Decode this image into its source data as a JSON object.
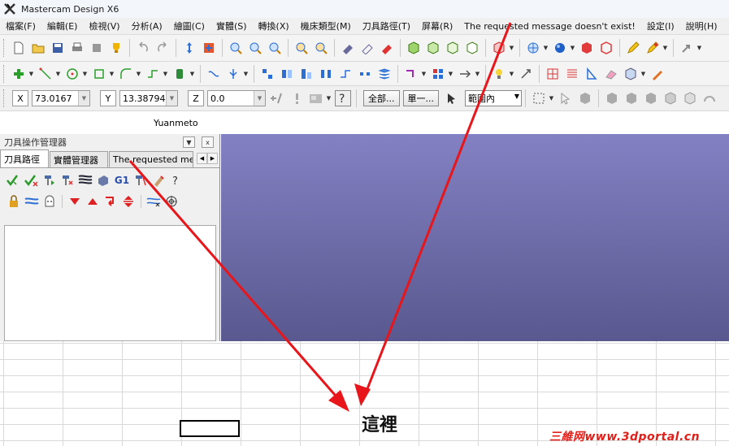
{
  "window": {
    "title": "Mastercam Design X6"
  },
  "menu": [
    "檔案(F)",
    "編輯(E)",
    "檢視(V)",
    "分析(A)",
    "繪圖(C)",
    "實體(S)",
    "轉換(X)",
    "機床類型(M)",
    "刀具路徑(T)",
    "屏幕(R)",
    "The requested message doesn't exist!",
    "設定(I)",
    "說明(H)"
  ],
  "coords": {
    "x_label": "X",
    "x_value": "73.0167",
    "y_label": "Y",
    "y_value": "13.38794",
    "z_label": "Z",
    "z_value": "0.0"
  },
  "selection": {
    "all_button": "全部...",
    "single_button": "單一...",
    "range_value": "範圍內"
  },
  "user": {
    "name": "Yuanmeto"
  },
  "panel": {
    "title": "刀具操作管理器",
    "close_glyph": "x",
    "tabs": [
      "刀具路徑",
      "實體管理器",
      "The requested messa"
    ],
    "g1_label": "G1"
  },
  "annotation": {
    "note": "這裡",
    "arrow_color": "#e8161b"
  },
  "watermark": "三維网www.3dportal.cn",
  "colors": {
    "viewport_top": "#8381c3",
    "viewport_bottom": "#59588f",
    "watermark": "#e0201b"
  },
  "icons": {
    "toolbar1": [
      "new-file-icon",
      "open-folder-icon",
      "save-icon",
      "print-icon",
      "cut-icon",
      "trophy-icon",
      "undo-icon",
      "redo-icon",
      "pan-icon",
      "fit-icon",
      "zoom-window-icon",
      "zoom-in-icon",
      "zoom-out-icon",
      "zoom-target-icon",
      "shade-icon",
      "wire-icon",
      "hidden-icon",
      "cube-iso-icon",
      "cube-top-icon",
      "cube-front-icon",
      "cube-right-icon",
      "cube-red-icon",
      "globe-icon",
      "sphere-icon",
      "red-cube-icon",
      "pencil-icon",
      "highlighter-icon",
      "arrow-icon"
    ],
    "toolbar2": [
      "point-icon",
      "line-icon",
      "circle-icon",
      "rectangle-icon",
      "arc-icon",
      "spline-icon",
      "cylinder-icon",
      "trim-icon",
      "split-icon",
      "transform-icon",
      "mirror-icon",
      "rotate-icon",
      "scale-icon",
      "offset-icon",
      "array-icon",
      "layer-icon",
      "bulb-icon",
      "dimension-icon",
      "table-icon",
      "chamfer-icon"
    ],
    "toolbar3": [
      "add-icon",
      "warning-icon",
      "image-icon",
      "help-icon",
      "select-arrow-icon",
      "box-select-icon"
    ]
  }
}
